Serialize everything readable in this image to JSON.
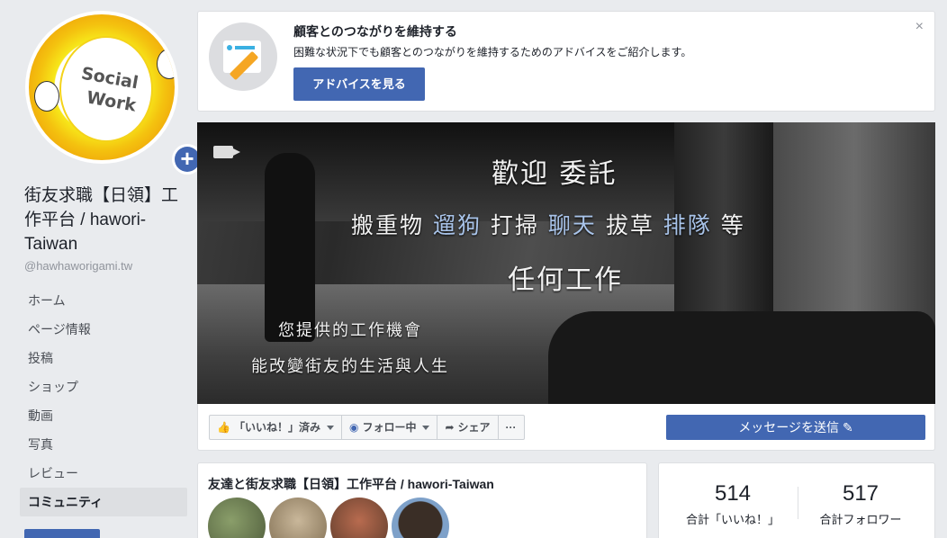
{
  "page": {
    "name": "街友求職【日領】工作平台 / hawori-Taiwan",
    "handle": "@hawhaworigami.tw",
    "avatar_text": [
      "Social",
      "Work"
    ]
  },
  "nav": {
    "items": [
      {
        "label": "ホーム"
      },
      {
        "label": "ページ情報"
      },
      {
        "label": "投稿"
      },
      {
        "label": "ショップ"
      },
      {
        "label": "動画"
      },
      {
        "label": "写真"
      },
      {
        "label": "レビュー"
      },
      {
        "label": "コミュニティ",
        "active": true
      }
    ]
  },
  "tip": {
    "title": "顧客とのつながりを維持する",
    "description": "困難な状況下でも顧客とのつながりを維持するためのアドバイスをご紹介します。",
    "button": "アドバイスを見る",
    "close": "×"
  },
  "cover": {
    "line1": "歡迎 委託",
    "line2": [
      {
        "text": "搬重物 ",
        "hl": false
      },
      {
        "text": "遛狗",
        "hl": true
      },
      {
        "text": " 打掃 ",
        "hl": false
      },
      {
        "text": "聊天",
        "hl": true
      },
      {
        "text": " 拔草 ",
        "hl": false
      },
      {
        "text": "排隊",
        "hl": true
      },
      {
        "text": " 等",
        "hl": false
      }
    ],
    "line3": "任何工作",
    "line4": "您提供的工作機會",
    "line5": "能改變街友的生活與人生"
  },
  "actions": {
    "like": "「いいね！」済み",
    "follow": "フォロー中",
    "share": "シェア",
    "more": "···",
    "message": "メッセージを送信"
  },
  "friends": {
    "title": "友達と街友求職【日領】工作平台 / hawori-Taiwan"
  },
  "stats": {
    "likes_count": "514",
    "likes_label": "合計「いいね！」",
    "followers_count": "517",
    "followers_label": "合計フォロワー"
  },
  "colors": {
    "brand": "#4267b2",
    "background": "#e9ebee",
    "cover_highlight": "#a9c4ea"
  }
}
